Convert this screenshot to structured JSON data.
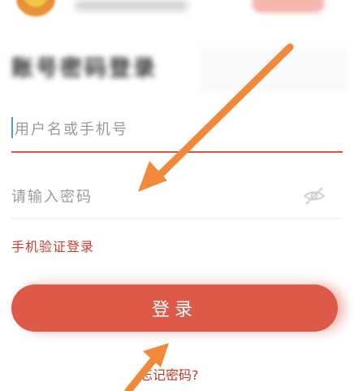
{
  "login": {
    "title": "账号密码登录",
    "username_placeholder": "用户名或手机号",
    "password_placeholder": "请输入密码",
    "sms_login_label": "手机验证登录",
    "submit_label": "登录",
    "forgot_password_label": "忘记密码?"
  },
  "colors": {
    "accent": "#de5a48",
    "link": "#cf3d2e",
    "annotation_arrow": "#f0893a"
  },
  "icons": {
    "password_visibility": "eye-closed-icon"
  }
}
